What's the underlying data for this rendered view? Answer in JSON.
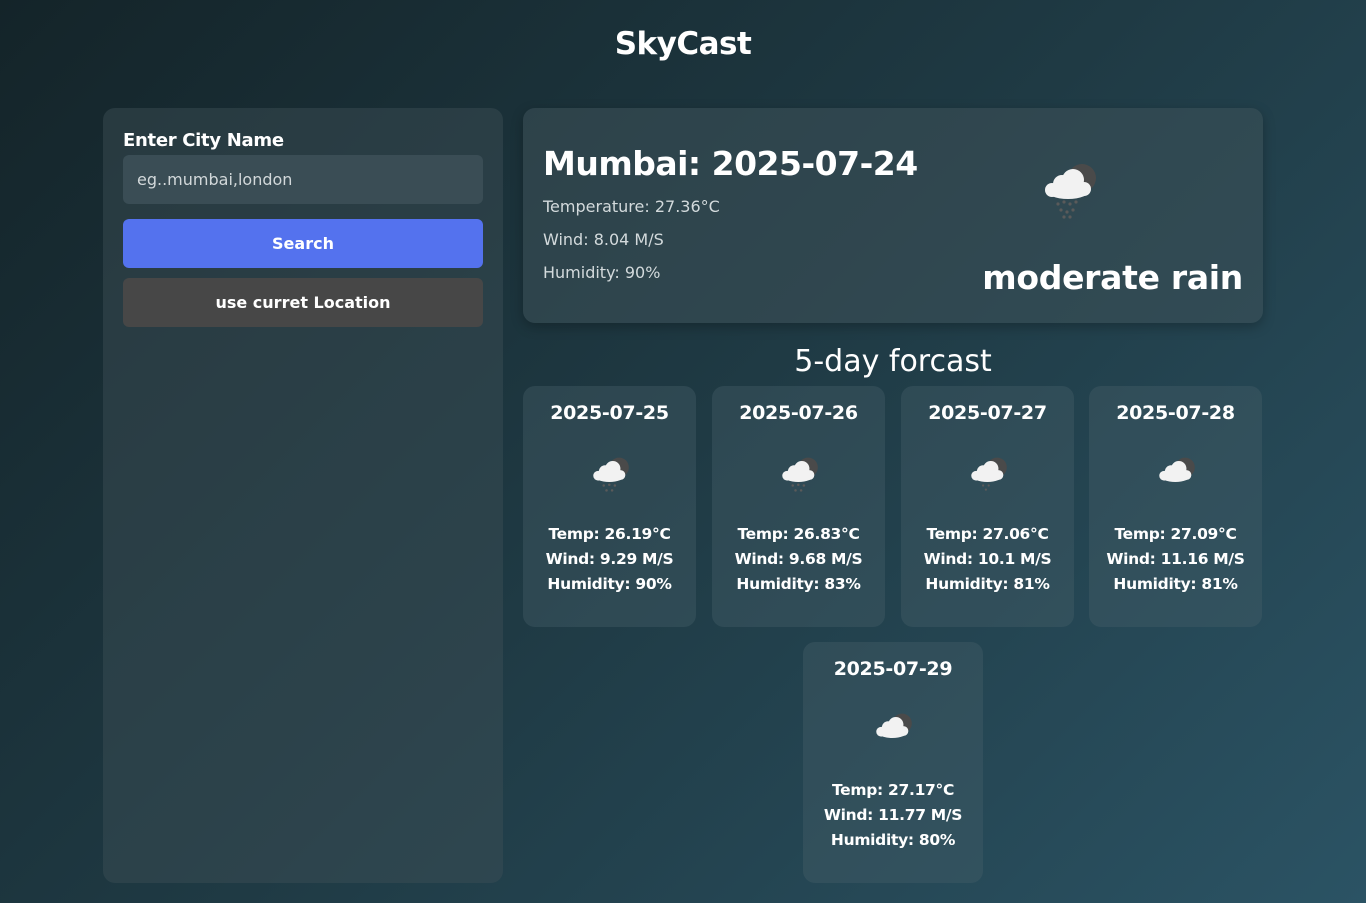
{
  "app": {
    "title": "SkyCast"
  },
  "search": {
    "label": "Enter City Name",
    "placeholder": "eg..mumbai,london",
    "value": "",
    "search_label": "Search",
    "location_label": "use curret Location"
  },
  "current": {
    "title": "Mumbai: 2025-07-24",
    "temperature": "Temperature: 27.36°C",
    "wind": "Wind: 8.04 M/S",
    "humidity": "Humidity: 90%",
    "description": "moderate rain",
    "icon": "cloud-rain-icon"
  },
  "forecast": {
    "heading": "5-day forcast",
    "days": [
      {
        "date": "2025-07-25",
        "temp": "Temp: 26.19°C",
        "wind": "Wind: 9.29 M/S",
        "humidity": "Humidity: 90%",
        "icon": "cloud-rain-icon"
      },
      {
        "date": "2025-07-26",
        "temp": "Temp: 26.83°C",
        "wind": "Wind: 9.68 M/S",
        "humidity": "Humidity: 83%",
        "icon": "cloud-rain-icon"
      },
      {
        "date": "2025-07-27",
        "temp": "Temp: 27.06°C",
        "wind": "Wind: 10.1 M/S",
        "humidity": "Humidity: 81%",
        "icon": "cloud-rain-icon"
      },
      {
        "date": "2025-07-28",
        "temp": "Temp: 27.09°C",
        "wind": "Wind: 11.16 M/S",
        "humidity": "Humidity: 81%",
        "icon": "cloud-icon"
      },
      {
        "date": "2025-07-29",
        "temp": "Temp: 27.17°C",
        "wind": "Wind: 11.77 M/S",
        "humidity": "Humidity: 80%",
        "icon": "cloud-icon"
      }
    ]
  },
  "colors": {
    "accent": "#5472ee",
    "secondary_button": "#474747",
    "background_dark": "#142429",
    "background_light": "#2b5364"
  }
}
